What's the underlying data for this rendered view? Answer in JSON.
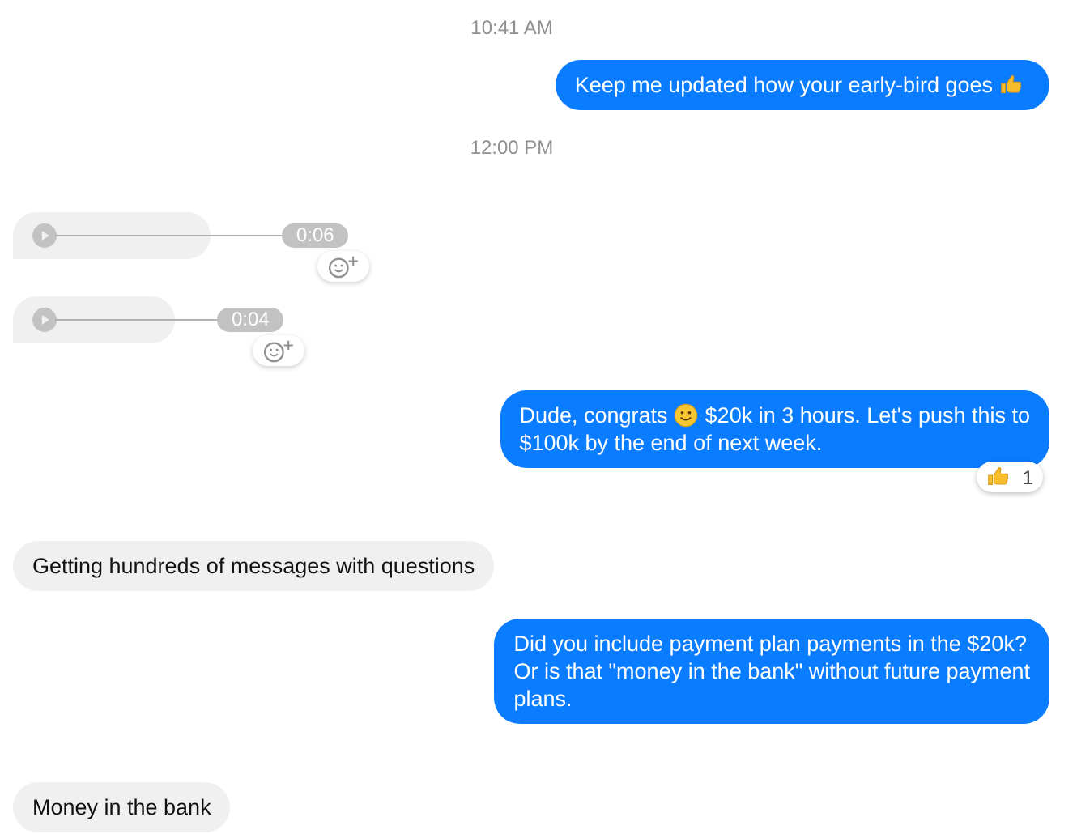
{
  "conversation": [
    {
      "kind": "timestamp",
      "text": "10:41 AM"
    },
    {
      "kind": "outgoing",
      "lines": [
        [
          {
            "kind": "text",
            "text": "Keep me updated how your early-bird goes"
          },
          {
            "kind": "thumb"
          }
        ]
      ]
    },
    {
      "kind": "timestamp",
      "text": "12:00 PM"
    },
    {
      "kind": "voice_long",
      "duration": "0:06"
    },
    {
      "kind": "voice_short",
      "duration": "0:04"
    },
    {
      "kind": "outgoing",
      "lines": [
        [
          {
            "kind": "text",
            "text": "Dude, congrats"
          },
          {
            "kind": "smile"
          },
          {
            "kind": "text",
            "text": "$20k in 3 hours. Let's push this to"
          }
        ],
        [
          {
            "kind": "text",
            "text": "$100k by the end of next week."
          }
        ]
      ],
      "reaction": {
        "count": "1"
      }
    },
    {
      "kind": "incoming",
      "lines": [
        [
          {
            "kind": "text",
            "text": "Getting hundreds of messages with questions"
          }
        ]
      ]
    },
    {
      "kind": "outgoing",
      "lines": [
        [
          {
            "kind": "text",
            "text": "Did you include payment plan payments in the $20k?"
          }
        ],
        [
          {
            "kind": "text",
            "text": "Or is that \"money in the bank\" without future payment"
          }
        ],
        [
          {
            "kind": "text",
            "text": "plans."
          }
        ]
      ]
    },
    {
      "kind": "incoming",
      "lines": [
        [
          {
            "kind": "text",
            "text": "Money in the bank"
          }
        ]
      ]
    }
  ]
}
